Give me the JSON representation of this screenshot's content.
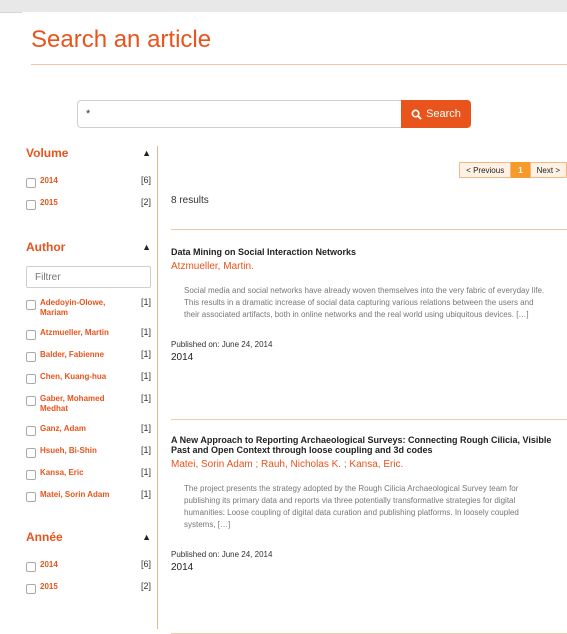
{
  "page": {
    "title": "Search an article"
  },
  "search": {
    "value": "*",
    "button_label": "Search"
  },
  "sidebar": {
    "volume": {
      "title": "Volume",
      "items": [
        {
          "label": "2014",
          "count": "[6]"
        },
        {
          "label": "2015",
          "count": "[2]"
        }
      ]
    },
    "author": {
      "title": "Author",
      "filter_placeholder": "Filtrer",
      "items": [
        {
          "label": "Adedoyin-Olowe, Mariam",
          "count": "[1]"
        },
        {
          "label": "Atzmueller, Martin",
          "count": "[1]"
        },
        {
          "label": "Balder, Fabienne",
          "count": "[1]"
        },
        {
          "label": "Chen, Kuang-hua",
          "count": "[1]"
        },
        {
          "label": "Gaber, Mohamed Medhat",
          "count": "[1]"
        },
        {
          "label": "Ganz, Adam",
          "count": "[1]"
        },
        {
          "label": "Hsueh, Bi-Shin",
          "count": "[1]"
        },
        {
          "label": "Kansa, Eric",
          "count": "[1]"
        },
        {
          "label": "Matei, Sorin Adam",
          "count": "[1]"
        }
      ]
    },
    "annee": {
      "title": "Année",
      "items": [
        {
          "label": "2014",
          "count": "[6]"
        },
        {
          "label": "2015",
          "count": "[2]"
        }
      ]
    }
  },
  "pagination": {
    "previous": "< Previous",
    "current": "1",
    "next": "Next >"
  },
  "results": {
    "count_text": "8 results",
    "items": [
      {
        "title": "Data Mining on Social Interaction Networks",
        "authors": "Atzmueller, Martin.",
        "abstract": "Social media and social networks have already woven themselves into the very fabric of everyday life. This results in a dramatic increase of social data capturing various relations between the users and their associated artifacts, both in online networks and the real world using ubiquitous devices. […]",
        "published": "Published on: June 24, 2014",
        "year": "2014"
      },
      {
        "title": "A New Approach to Reporting Archaeological Surveys: Connecting Rough Cilicia, Visible Past and Open Context through loose coupling and 3d codes",
        "authors": "Matei, Sorin Adam ; Rauh, Nicholas K. ; Kansa, Eric.",
        "abstract": "The project presents the strategy adopted by the Rough Cilicia Archaeological Survey team for publishing its primary data and reports via three potentially transformative strategies for digital humanities: Loose coupling of digital data curation and publishing platforms. In loosely coupled systems, […]",
        "published": "Published on: June 24, 2014",
        "year": "2014"
      }
    ]
  },
  "colors": {
    "accent": "#e8541c",
    "pager_current": "#f79a2a",
    "rule": "#f2c9a8"
  }
}
